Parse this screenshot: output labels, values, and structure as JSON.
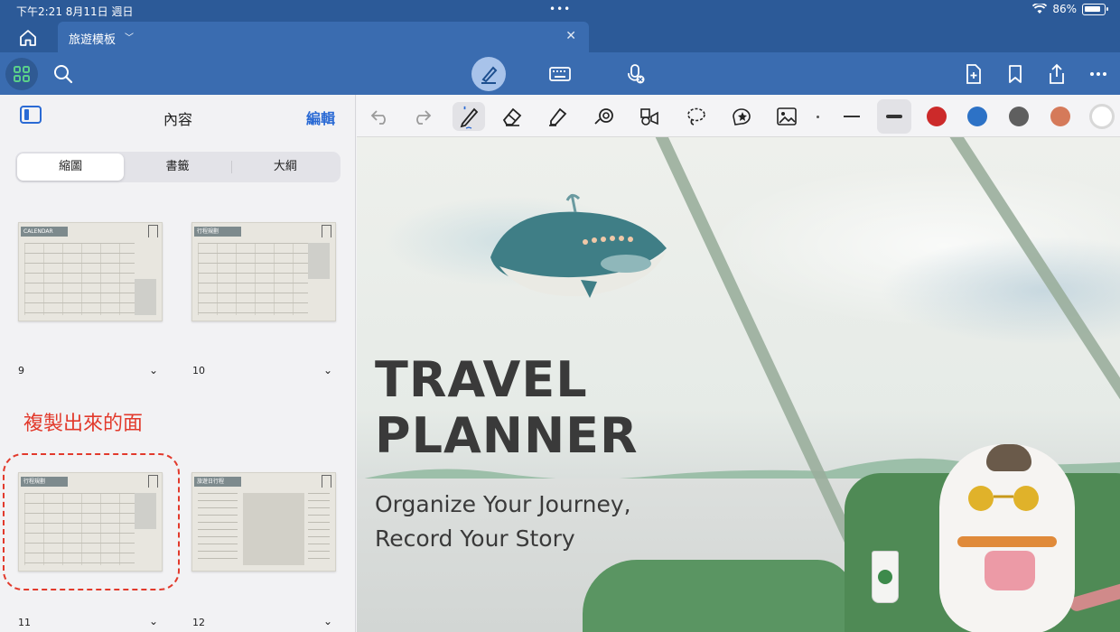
{
  "status_bar": {
    "time": "下午2:21  8月11日 週日",
    "dots": "•••",
    "battery": "86%"
  },
  "tab": {
    "name": "旅遊模板"
  },
  "sidebar": {
    "title": "內容",
    "edit": "編輯",
    "segments": [
      "縮圖",
      "書籤",
      "大綱"
    ],
    "pages": [
      {
        "num": "9",
        "label": "CALENDAR"
      },
      {
        "num": "10",
        "label": "行程規劃"
      },
      {
        "num": "11",
        "label": "行程規劃"
      },
      {
        "num": "12",
        "label": "旅遊日行程"
      }
    ],
    "annotation": "複製出來的面"
  },
  "toolbar": {
    "icons": [
      "grid-icon",
      "search-icon",
      "pen-mode-icon",
      "keyboard-icon",
      "mic-icon",
      "add-page-icon",
      "bookmark-icon",
      "share-icon",
      "more-icon"
    ]
  },
  "drawbar": {
    "colors": [
      "#cc2a2a",
      "#2d72c6",
      "#5f5f5f",
      "#d57a5a",
      "#ffffff"
    ]
  },
  "canvas": {
    "title_line1": "TRAVEL",
    "title_line2": "PLANNER",
    "subtitle_line1": "Organize Your Journey,",
    "subtitle_line2": "Record Your Story"
  }
}
